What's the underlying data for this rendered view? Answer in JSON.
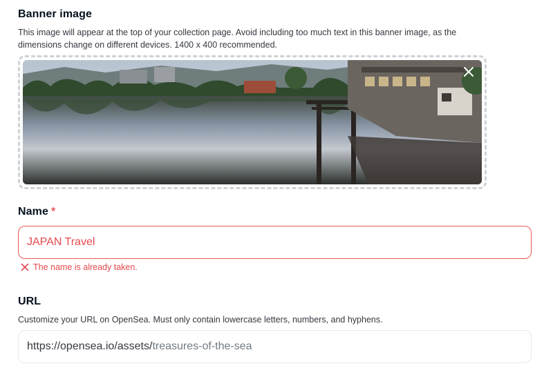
{
  "banner": {
    "title": "Banner image",
    "description_line1": "This image will appear at the top of your collection page. Avoid including too much text in this banner image, as the",
    "description_line2": "dimensions change on different devices. 1400 x 400 recommended.",
    "close_icon": "close-icon"
  },
  "name": {
    "label": "Name",
    "required_mark": "*",
    "value": "JAPAN Travel",
    "error": "The name is already taken.",
    "error_color": "#e5484d"
  },
  "url": {
    "label": "URL",
    "description": "Customize your URL on OpenSea. Must only contain lowercase letters, numbers, and hyphens.",
    "prefix": "https://opensea.io/assets/",
    "value": "treasures-of-the-sea"
  }
}
